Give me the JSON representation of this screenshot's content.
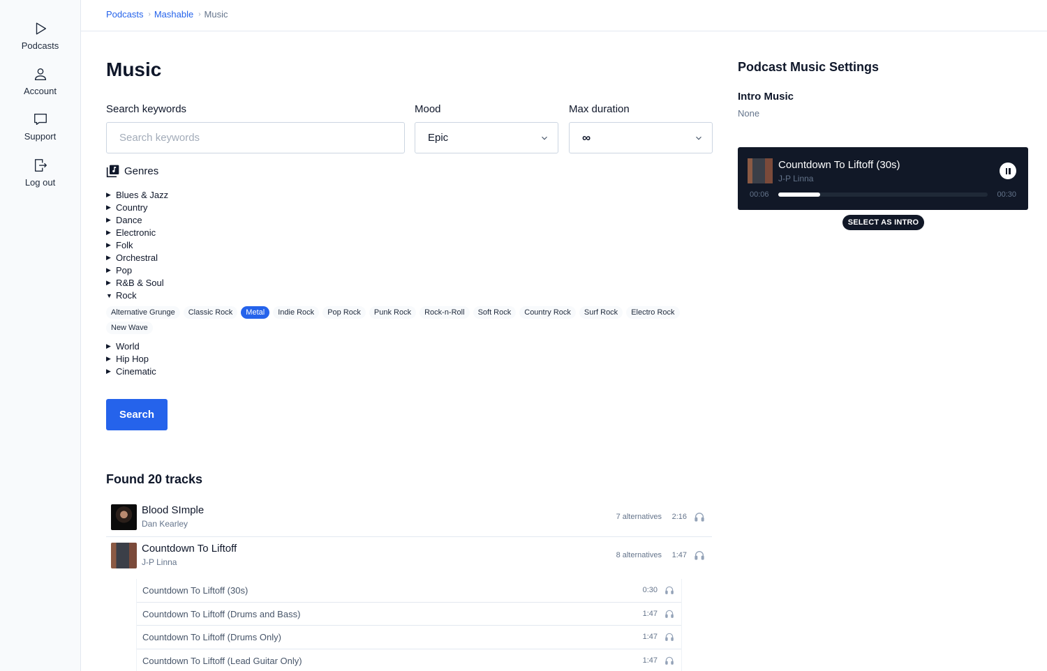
{
  "sidebar": {
    "items": [
      {
        "label": "Podcasts",
        "icon": "play-icon"
      },
      {
        "label": "Account",
        "icon": "user-icon"
      },
      {
        "label": "Support",
        "icon": "chat-icon"
      },
      {
        "label": "Log out",
        "icon": "logout-icon"
      }
    ]
  },
  "breadcrumb": {
    "items": [
      "Podcasts",
      "Mashable"
    ],
    "current": "Music",
    "separator": "›"
  },
  "page": {
    "title": "Music"
  },
  "filters": {
    "keywords": {
      "label": "Search keywords",
      "placeholder": "Search keywords",
      "value": ""
    },
    "mood": {
      "label": "Mood",
      "value": "Epic"
    },
    "max_duration": {
      "label": "Max duration",
      "value": "∞"
    }
  },
  "genres": {
    "title": "Genres",
    "collapsed_before": [
      "Blues & Jazz",
      "Country",
      "Dance",
      "Electronic",
      "Folk",
      "Orchestral",
      "Pop",
      "R&B & Soul"
    ],
    "expanded": {
      "label": "Rock",
      "subgenres": [
        "Alternative Grunge",
        "Classic Rock",
        "Metal",
        "Indie Rock",
        "Pop Rock",
        "Punk Rock",
        "Rock-n-Roll",
        "Soft Rock",
        "Country Rock",
        "Surf Rock",
        "Electro Rock",
        "New Wave"
      ],
      "selected": "Metal"
    },
    "collapsed_after": [
      "World",
      "Hip Hop",
      "Cinematic"
    ]
  },
  "search_button": "Search",
  "results": {
    "heading": "Found 20 tracks",
    "tracks": [
      {
        "name": "Blood SImple",
        "artist": "Dan Kearley",
        "alternatives": "7 alternatives",
        "duration": "2:16"
      },
      {
        "name": "Countdown To Liftoff",
        "artist": "J-P Linna",
        "alternatives": "8 alternatives",
        "duration": "1:47"
      }
    ],
    "alternatives": [
      {
        "name": "Countdown To Liftoff (30s)",
        "duration": "0:30"
      },
      {
        "name": "Countdown To Liftoff (Drums and Bass)",
        "duration": "1:47"
      },
      {
        "name": "Countdown To Liftoff (Drums Only)",
        "duration": "1:47"
      },
      {
        "name": "Countdown To Liftoff (Lead Guitar Only)",
        "duration": "1:47"
      }
    ]
  },
  "settings": {
    "title": "Podcast Music Settings",
    "intro_label": "Intro Music",
    "intro_value": "None",
    "player": {
      "title": "Countdown To Liftoff (30s)",
      "artist": "J-P Linna",
      "current": "00:06",
      "total": "00:30",
      "progress": 0.2
    },
    "select_button": "SELECT AS INTRO"
  },
  "colors": {
    "accent": "#2563eb",
    "dark": "#111827"
  }
}
